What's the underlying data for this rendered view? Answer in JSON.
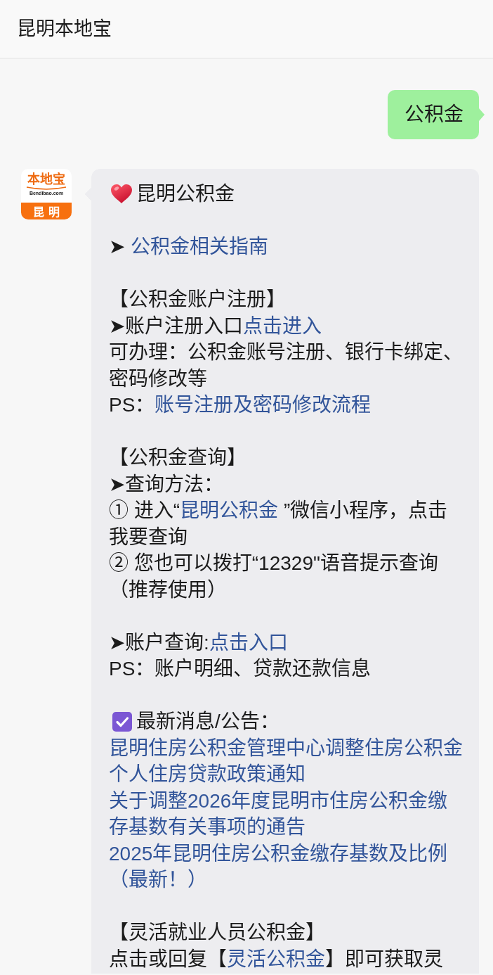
{
  "header": {
    "title": "昆明本地宝"
  },
  "messages": [
    {
      "kind": "user",
      "text": "公积金"
    },
    {
      "kind": "bot",
      "avatar": {
        "brand": "本地宝",
        "domain": "Bendibao.com",
        "city": "昆明"
      },
      "sections": [
        {
          "lines": [
            {
              "kind": "heart",
              "text": "昆明公积金"
            }
          ]
        },
        {
          "lines": [
            {
              "kind": "text",
              "parts": [
                {
                  "kind": "text",
                  "text": "➤ "
                },
                {
                  "kind": "link",
                  "text": "公积金相关指南"
                }
              ]
            }
          ]
        },
        {
          "lines": [
            {
              "kind": "text",
              "parts": [
                {
                  "kind": "text",
                  "text": "【公积金账户注册】"
                }
              ]
            },
            {
              "kind": "text",
              "parts": [
                {
                  "kind": "text",
                  "text": "➤账户注册入口"
                },
                {
                  "kind": "link",
                  "text": "点击进入"
                }
              ]
            },
            {
              "kind": "text",
              "parts": [
                {
                  "kind": "text",
                  "text": "可办理：公积金账号注册、银行卡绑定、密码修改等"
                }
              ]
            },
            {
              "kind": "text",
              "parts": [
                {
                  "kind": "text",
                  "text": "PS："
                },
                {
                  "kind": "link",
                  "text": "账号注册及密码修改流程"
                }
              ]
            }
          ]
        },
        {
          "lines": [
            {
              "kind": "text",
              "parts": [
                {
                  "kind": "text",
                  "text": "【公积金查询】"
                }
              ]
            },
            {
              "kind": "text",
              "parts": [
                {
                  "kind": "text",
                  "text": "➤查询方法："
                }
              ]
            },
            {
              "kind": "text",
              "parts": [
                {
                  "kind": "text",
                  "text": "① 进入“"
                },
                {
                  "kind": "link",
                  "text": "昆明公积金"
                },
                {
                  "kind": "text",
                  "text": " ”微信小程序，点击我要查询"
                }
              ]
            },
            {
              "kind": "text",
              "parts": [
                {
                  "kind": "text",
                  "text": "② 您也可以拨打“12329\"语音提示查询（推荐使用）"
                }
              ]
            }
          ]
        },
        {
          "lines": [
            {
              "kind": "text",
              "parts": [
                {
                  "kind": "text",
                  "text": "➤账户查询:"
                },
                {
                  "kind": "link",
                  "text": "点击入口"
                }
              ]
            },
            {
              "kind": "text",
              "parts": [
                {
                  "kind": "text",
                  "text": "PS：账户明细、贷款还款信息"
                }
              ]
            }
          ]
        },
        {
          "lines": [
            {
              "kind": "check",
              "text": "最新消息/公告："
            },
            {
              "kind": "link",
              "text": "昆明住房公积金管理中心调整住房公积金个人住房贷款政策通知"
            },
            {
              "kind": "link",
              "text": "关于调整2026年度昆明市住房公积金缴存基数有关事项的通告"
            },
            {
              "kind": "link",
              "text": "2025年昆明住房公积金缴存基数及比例（最新！）"
            }
          ]
        },
        {
          "lines": [
            {
              "kind": "text",
              "parts": [
                {
                  "kind": "text",
                  "text": "【灵活就业人员公积金】"
                }
              ]
            },
            {
              "kind": "text",
              "parts": [
                {
                  "kind": "text",
                  "text": "点击或回复【"
                },
                {
                  "kind": "link",
                  "text": "灵活公积金"
                },
                {
                  "kind": "text",
                  "text": "】即可获取灵"
                }
              ]
            }
          ]
        }
      ]
    }
  ]
}
